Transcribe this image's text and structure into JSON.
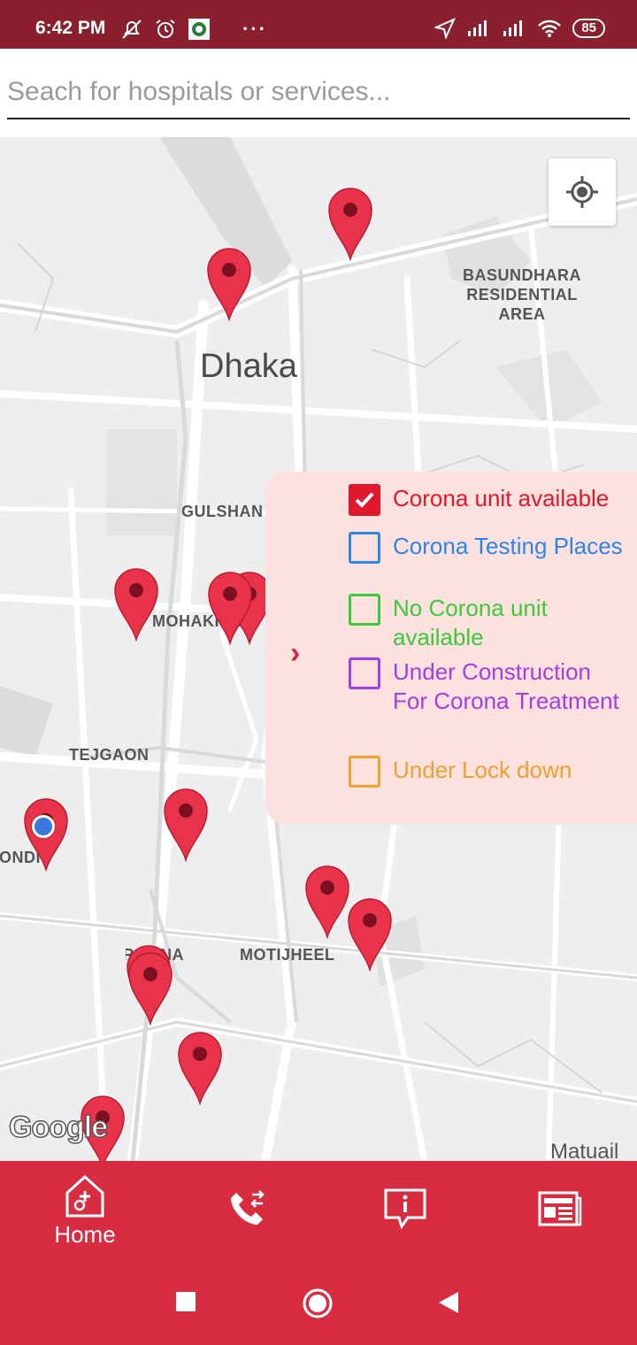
{
  "status_bar": {
    "time": "6:42 PM",
    "battery": "85",
    "icons": [
      "mute-icon",
      "alarm-icon",
      "app-notification-icon",
      "more-icon",
      "location-arrow-icon",
      "signal-icon",
      "signal-icon",
      "wifi-icon",
      "battery-icon"
    ]
  },
  "search": {
    "placeholder": "Seach for hospitals or services...",
    "value": ""
  },
  "map": {
    "city": "Dhaka",
    "areas": {
      "basundhara": "BASUNDHARA\nRESIDENTIAL\nAREA",
      "gulshan": "GULSHAN",
      "mohakhali": "MOHAKHALI",
      "tejgaon": "TEJGAON",
      "motijheel": "MOTIJHEEL",
      "ramna": "RAMNA",
      "dhanmondi": "DHANMONDI",
      "matuail": "Matuail"
    },
    "attribution": "Google",
    "marker_color": "#e8334a"
  },
  "legend": {
    "toggle_icon": "chevron-right-icon",
    "items": [
      {
        "label": "Corona unit available",
        "color": "#e0182d",
        "checked": true
      },
      {
        "label": "Corona Testing Places",
        "color": "#2a86e8",
        "checked": false
      },
      {
        "label": "No Corona unit available",
        "color": "#3cc93c",
        "checked": false
      },
      {
        "label": "Under Construction For Corona Treatment",
        "color": "#a33ee0",
        "checked": false
      },
      {
        "label": "Under Lock down",
        "color": "#f0a030",
        "checked": false
      }
    ]
  },
  "bottom_nav": {
    "items": [
      {
        "label": "Home",
        "icon": "hospital-home-icon",
        "active": true
      },
      {
        "label": "",
        "icon": "phone-transfer-icon",
        "active": false
      },
      {
        "label": "",
        "icon": "info-chat-icon",
        "active": false
      },
      {
        "label": "",
        "icon": "newspaper-icon",
        "active": false
      }
    ]
  },
  "colors": {
    "status_bar": "#8a1f2e",
    "nav_bar": "#d82c40",
    "legend_bg": "#fde1de"
  }
}
